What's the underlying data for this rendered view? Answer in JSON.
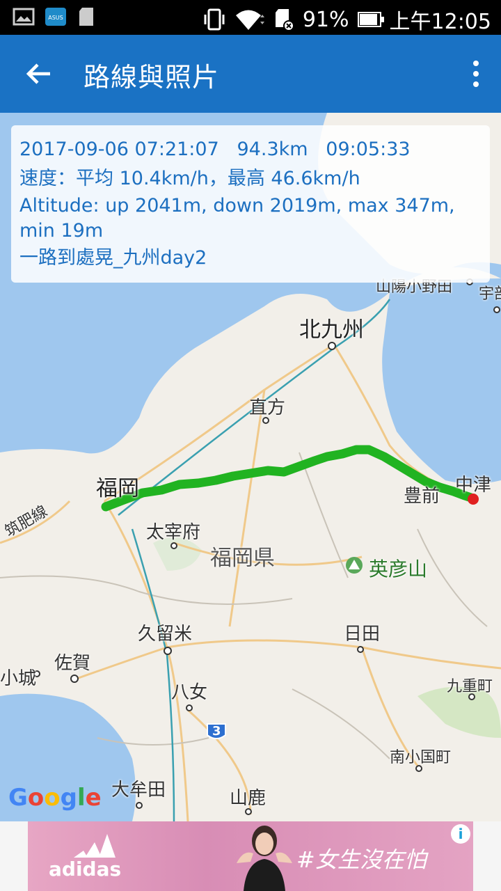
{
  "status_bar": {
    "battery": "91%",
    "time": "上午12:05",
    "battery_level": 0.91
  },
  "app_bar": {
    "title": "路線與照片"
  },
  "trip": {
    "summary": "2017-09-06 07:21:07   94.3km   09:05:33",
    "speed": "速度：平均 10.4km/h，最高 46.6km/h",
    "altitude": "Altitude: up 2041m, down 2019m, max 347m, min 19m",
    "name": "一路到處晃_九州day2"
  },
  "map": {
    "labels": {
      "kitakyushu": "北九州",
      "nogata": "直方",
      "fukuoka": "福岡",
      "dazaifu": "太宰府",
      "fukuoka_pref": "福岡県",
      "buzen": "豊前",
      "nakatsu": "中津",
      "hikosan": "英彦山",
      "kurume": "久留米",
      "hita": "日田",
      "saga": "佐賀",
      "ogi": "小城",
      "yame": "八女",
      "kokonoe": "九重町",
      "minamioguni": "南小国町",
      "omuta": "大牟田",
      "yamaga": "山鹿",
      "sanyo_onoda": "山陽小野田",
      "ube": "宇部",
      "chikuhi": "筑肥線",
      "route3": "3"
    },
    "google": "Google",
    "route_color": "#21b321",
    "end_marker_color": "#e02020"
  },
  "ad": {
    "brand": "adidas",
    "slogan": "#女生沒在怕",
    "info": "i"
  }
}
